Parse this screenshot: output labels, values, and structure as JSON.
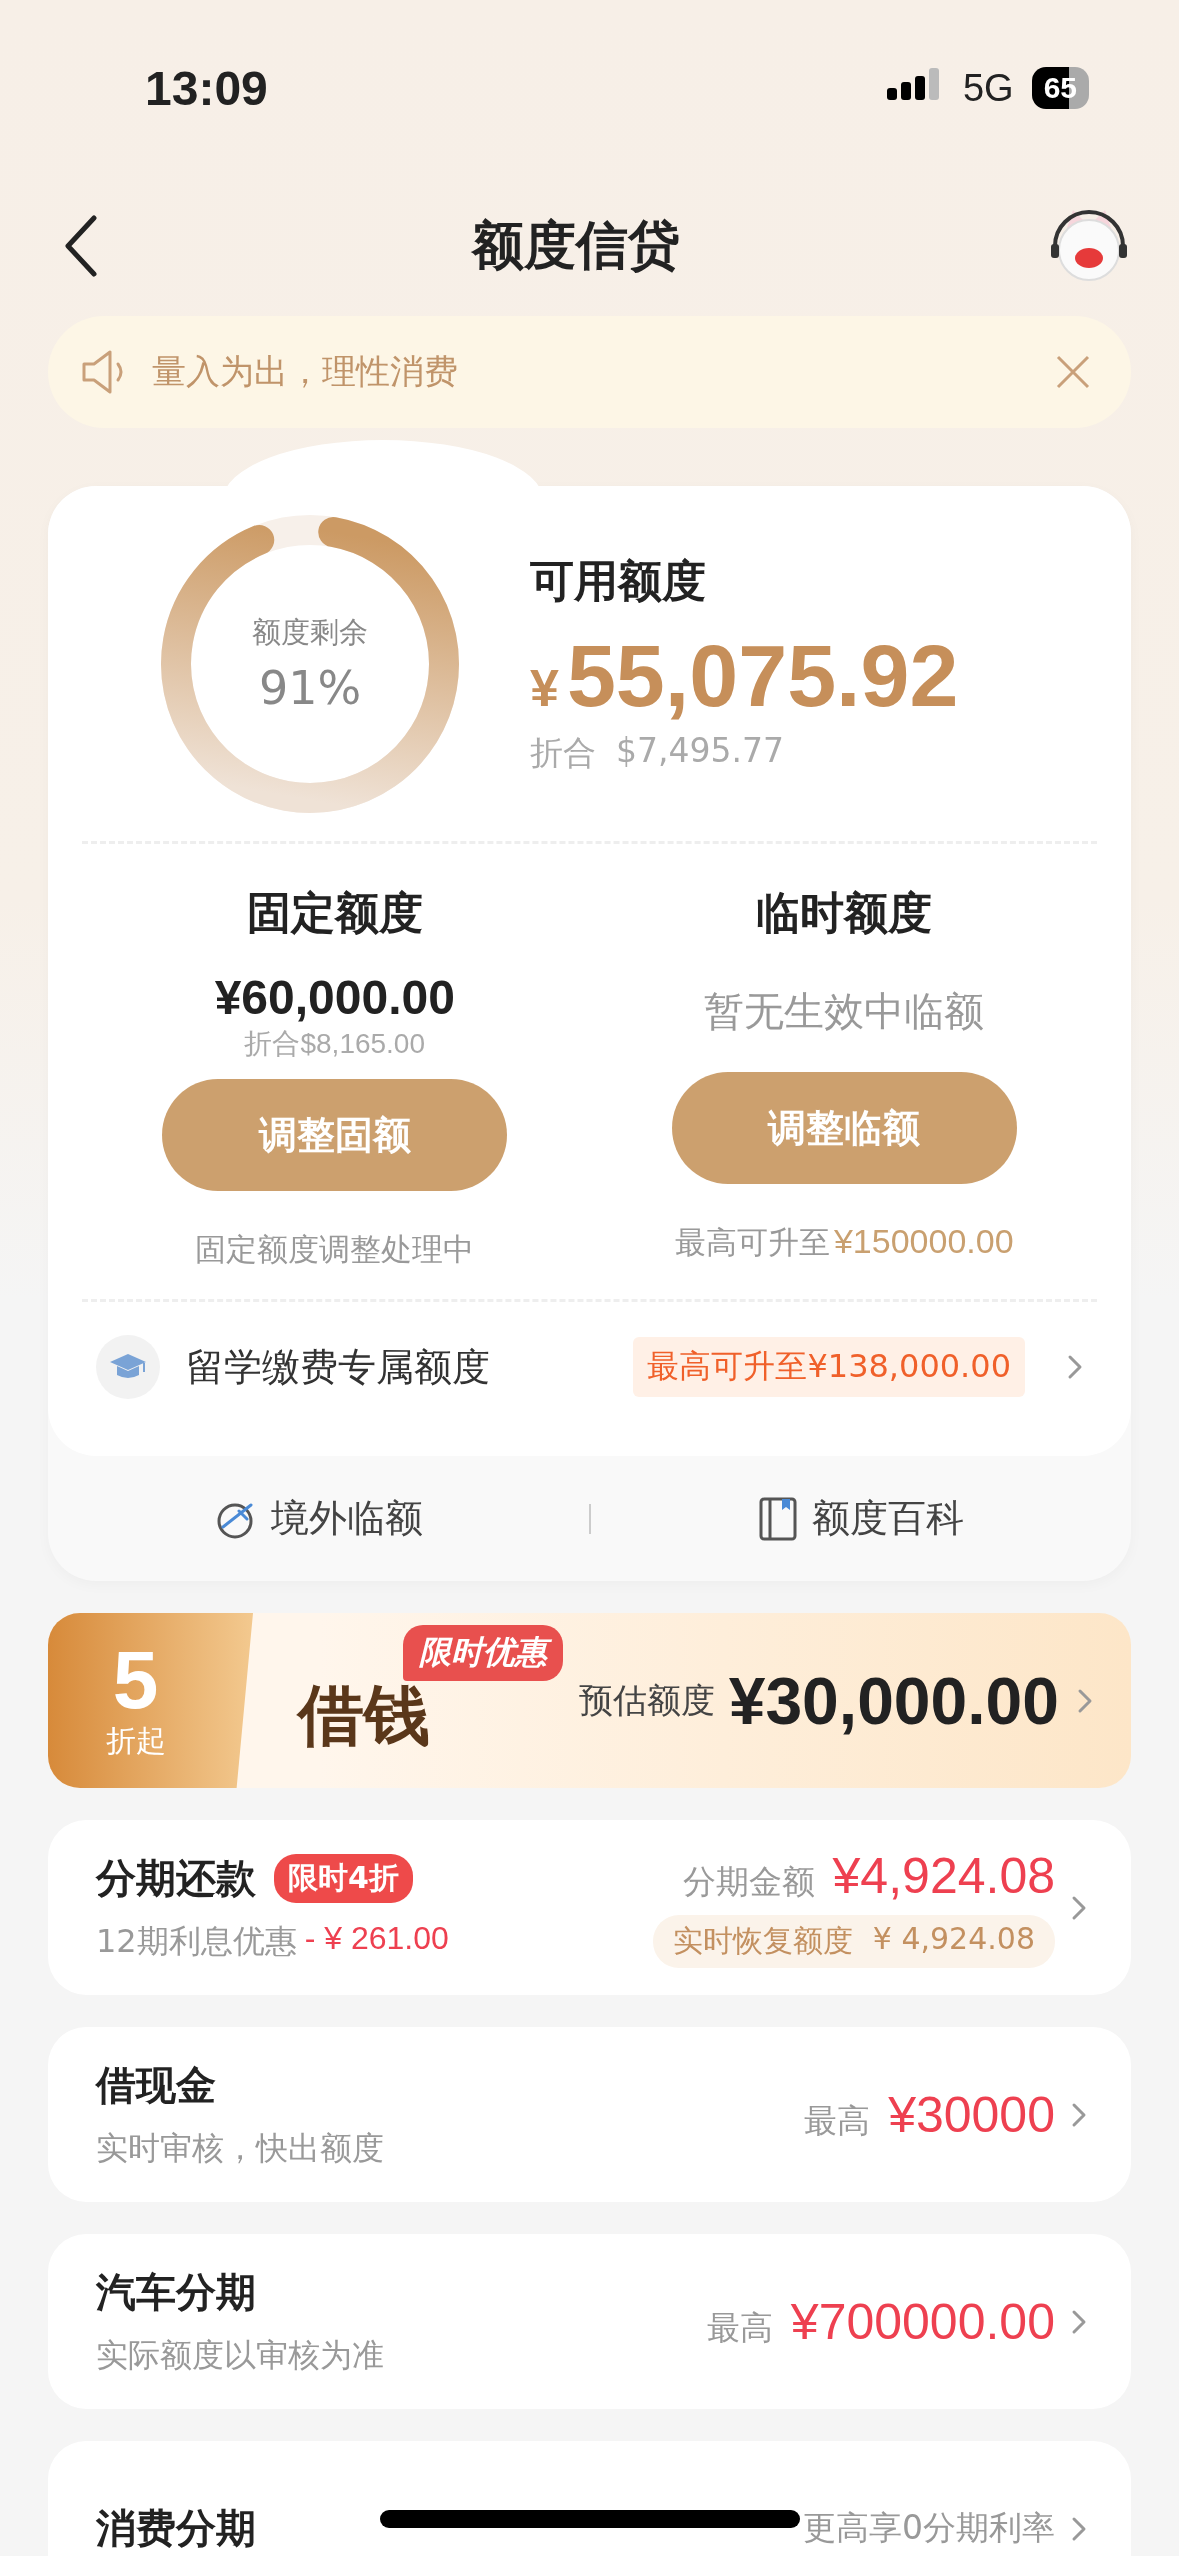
{
  "status_bar": {
    "time": "13:09",
    "network": "5G",
    "battery": "65"
  },
  "nav": {
    "title": "额度信贷"
  },
  "notice": {
    "text": "量入为出，理性消费"
  },
  "quota": {
    "ring_label": "额度剩余",
    "ring_percent": "91%",
    "level": 0.91,
    "title": "可用额度",
    "currency": "¥",
    "amount": "55,075.92",
    "converted_label": "折合",
    "converted": "$7,495.77"
  },
  "limits": [
    {
      "title": "固定额度",
      "amount": "¥60,000.00",
      "sub": "折合$8,165.00",
      "button": "调整固额",
      "note": "固定额度调整处理中"
    },
    {
      "title": "临时额度",
      "status": "暂无生效中临额",
      "button": "调整临额",
      "note": "最高可升至",
      "note_value": "¥150000.00"
    }
  ],
  "study": {
    "label": "留学缴费专属额度",
    "badge": "最高可升至¥138,000.00"
  },
  "links": [
    {
      "label": "境外临额"
    },
    {
      "label": "额度百科"
    }
  ],
  "loan_banner": {
    "discount": "5",
    "discount_unit": "折起",
    "title": "借钱",
    "tag": "限时优惠",
    "estimate_label": "预估额度",
    "estimate": "¥30,000.00"
  },
  "products": [
    {
      "title": "分期还款",
      "tag": "限时4折",
      "subtitle": "12期利息优惠",
      "subtitle_value": "- ¥ 261.00",
      "amount_label": "分期金额",
      "amount": "¥4,924.08",
      "chip_label": "实时恢复额度",
      "chip_value": "¥ 4,924.08"
    },
    {
      "title": "借现金",
      "subtitle": "实时审核，快出额度",
      "amount_label": "最高",
      "amount": "¥30000"
    },
    {
      "title": "汽车分期",
      "subtitle": "实际额度以审核为准",
      "amount_label": "最高",
      "amount": "¥700000.00"
    },
    {
      "title": "消费分期",
      "amount_label": "更高享0分期利率"
    }
  ]
}
